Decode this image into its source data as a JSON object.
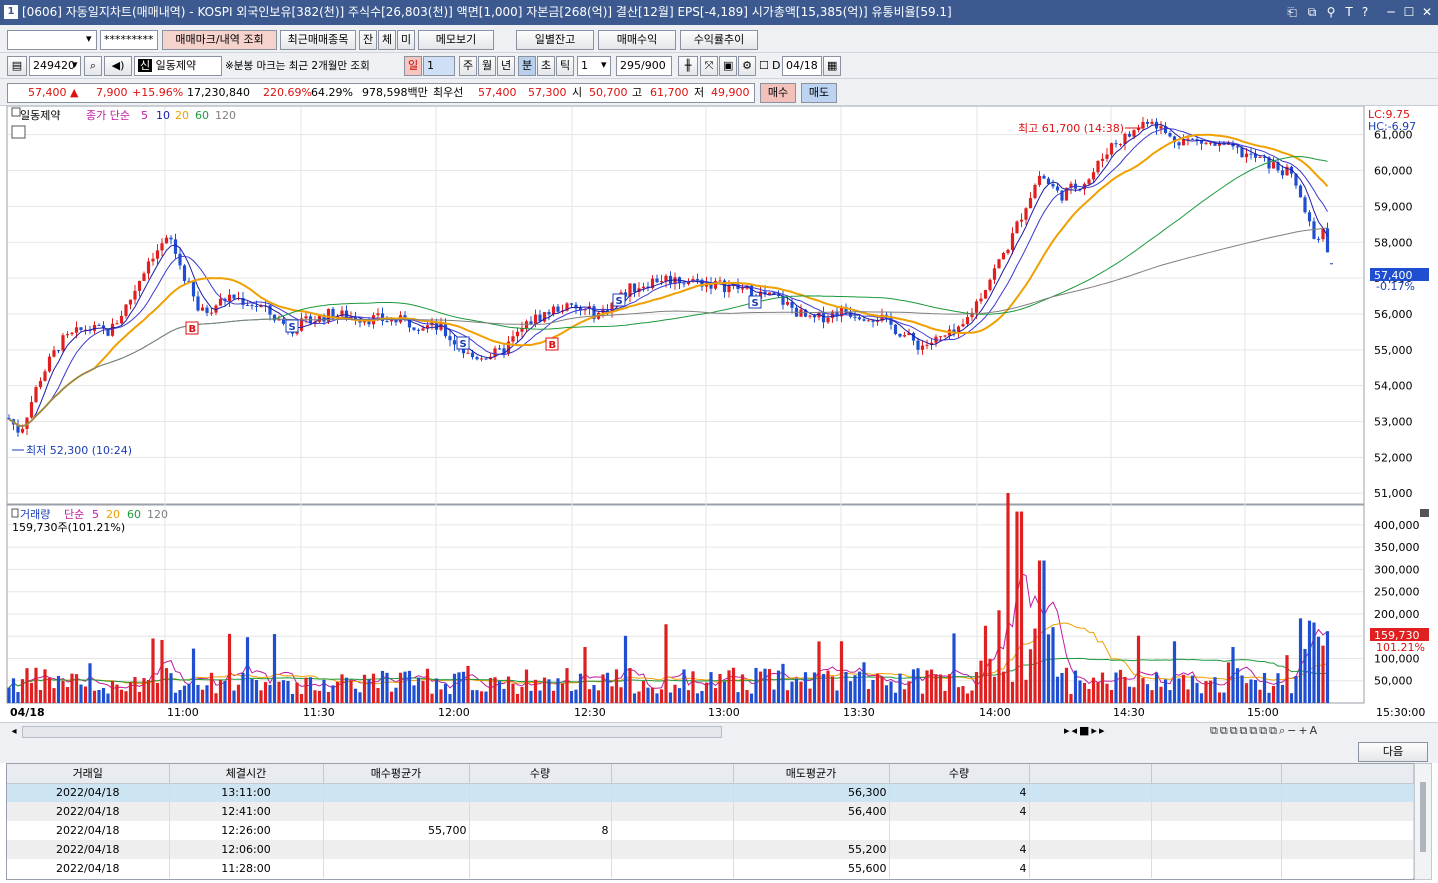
{
  "title_bar": {
    "window_number": "1",
    "text": "[0606] 자동일지차트(매매내역) - KOSPI 외국인보유[382(천)] 주식수[26,803(천)] 액면[1,000] 자본금[268(억)] 결산[12월] EPS[-4,189] 시가총액[15,385(억)] 유통비율[59.1]",
    "icons": [
      "dock-icon",
      "restore-icon",
      "pin-icon",
      "font-icon",
      "help-icon",
      "minimize-icon",
      "maximize-icon",
      "close-icon"
    ],
    "icon_glyphs": [
      "⎗",
      "⧉",
      "⚲",
      "T",
      "?",
      "─",
      "☐",
      "✕"
    ]
  },
  "toolbar1": {
    "account_value": "",
    "password_value": "*********",
    "btn_mark": "매매마크/내역 조회",
    "btn_recent": "최근매매종목",
    "btn_jan": "잔",
    "btn_che": "체",
    "btn_mi": "미",
    "btn_memo": "메모보기",
    "btn_daily": "일별잔고",
    "btn_profit": "매매수익",
    "btn_return": "수익률추이"
  },
  "toolbar2": {
    "code": "249420",
    "stock_name": "일동제약",
    "notice": "※분봉 마크는 최근 2개월만 조회",
    "periods": [
      "일",
      "1",
      "주",
      "월",
      "년",
      "분",
      "초",
      "틱"
    ],
    "tick_value": "1",
    "count": "295/900",
    "check_label": "D",
    "date": "04/18"
  },
  "quote": {
    "price": "57,400",
    "arrow": "▲",
    "change": "7,900",
    "change_pct": "+15.96%",
    "volume": "17,230,840",
    "vol_ratio": "220.69%",
    "turnover": "64.29%",
    "amount": "978,598백만",
    "best_label": "최우선",
    "ask": "57,400",
    "bid": "57,300",
    "open_label": "시",
    "open": "50,700",
    "high_label": "고",
    "high": "61,700",
    "low_label": "저",
    "low": "49,900",
    "buy_btn": "매수",
    "sell_btn": "매도"
  },
  "colors": {
    "up": "#e02020",
    "down": "#1f4fd0",
    "ma5": "#1a1aa8",
    "ma10": "#1a1aa8",
    "ma20": "#f0a000",
    "ma60": "#1a9a3a",
    "ma120": "#808080",
    "volbar_up": "#e02020",
    "volbar_down": "#1f4fd0"
  },
  "price_panel": {
    "legend_stock": "일동제약",
    "legend_label": "종가 단순",
    "ma_periods": [
      "5",
      "10",
      "20",
      "60",
      "120"
    ],
    "lc": "LC:9.75",
    "hc": "HC:-6.97",
    "max_label": "최고 61,700 (14:38)",
    "min_label": "최저 52,300 (10:24)",
    "last_price": "57,400",
    "last_pct": "-0.17%",
    "y_ticks": [
      "61,000",
      "60,000",
      "59,000",
      "58,000",
      "57,000",
      "56,000",
      "55,000",
      "54,000",
      "53,000",
      "52,000",
      "51,000"
    ]
  },
  "volume_panel": {
    "legend_label": "거래량",
    "legend_ma": "단순",
    "ma_periods": [
      "5",
      "20",
      "60",
      "120"
    ],
    "last_volume": "159,730주(101.21%)",
    "last_badge": "159,730",
    "last_pct": "101.21%",
    "y_ticks": [
      "400,000",
      "350,000",
      "300,000",
      "250,000",
      "200,000",
      "150,000",
      "100,000",
      "50,000"
    ]
  },
  "x_axis": {
    "labels": [
      "04/18",
      "11:00",
      "11:30",
      "12:00",
      "12:30",
      "13:00",
      "13:30",
      "14:00",
      "14:30",
      "15:00",
      "15:30:00"
    ]
  },
  "chart_data": {
    "type": "candlestick",
    "interval": "1분",
    "ylim": [
      51000,
      61700
    ],
    "volume_ylim": [
      0,
      400000
    ],
    "high": 61700,
    "low": 52300,
    "last": 57400,
    "max_volume": 159730
  },
  "panel": {
    "next_btn": "다음"
  },
  "table": {
    "headers": [
      "거래일",
      "체결시간",
      "매수평균가",
      "수량",
      "",
      "매도평균가",
      "수량",
      "",
      "",
      ""
    ],
    "rows": [
      [
        "2022/04/18",
        "13:11:00",
        "",
        "",
        "",
        "56,300",
        "4",
        "",
        "",
        ""
      ],
      [
        "2022/04/18",
        "12:41:00",
        "",
        "",
        "",
        "56,400",
        "4",
        "",
        "",
        ""
      ],
      [
        "2022/04/18",
        "12:26:00",
        "55,700",
        "8",
        "",
        "",
        "",
        "",
        "",
        ""
      ],
      [
        "2022/04/18",
        "12:06:00",
        "",
        "",
        "",
        "55,200",
        "4",
        "",
        "",
        ""
      ],
      [
        "2022/04/18",
        "11:28:00",
        "",
        "",
        "",
        "55,600",
        "4",
        "",
        "",
        ""
      ]
    ]
  }
}
